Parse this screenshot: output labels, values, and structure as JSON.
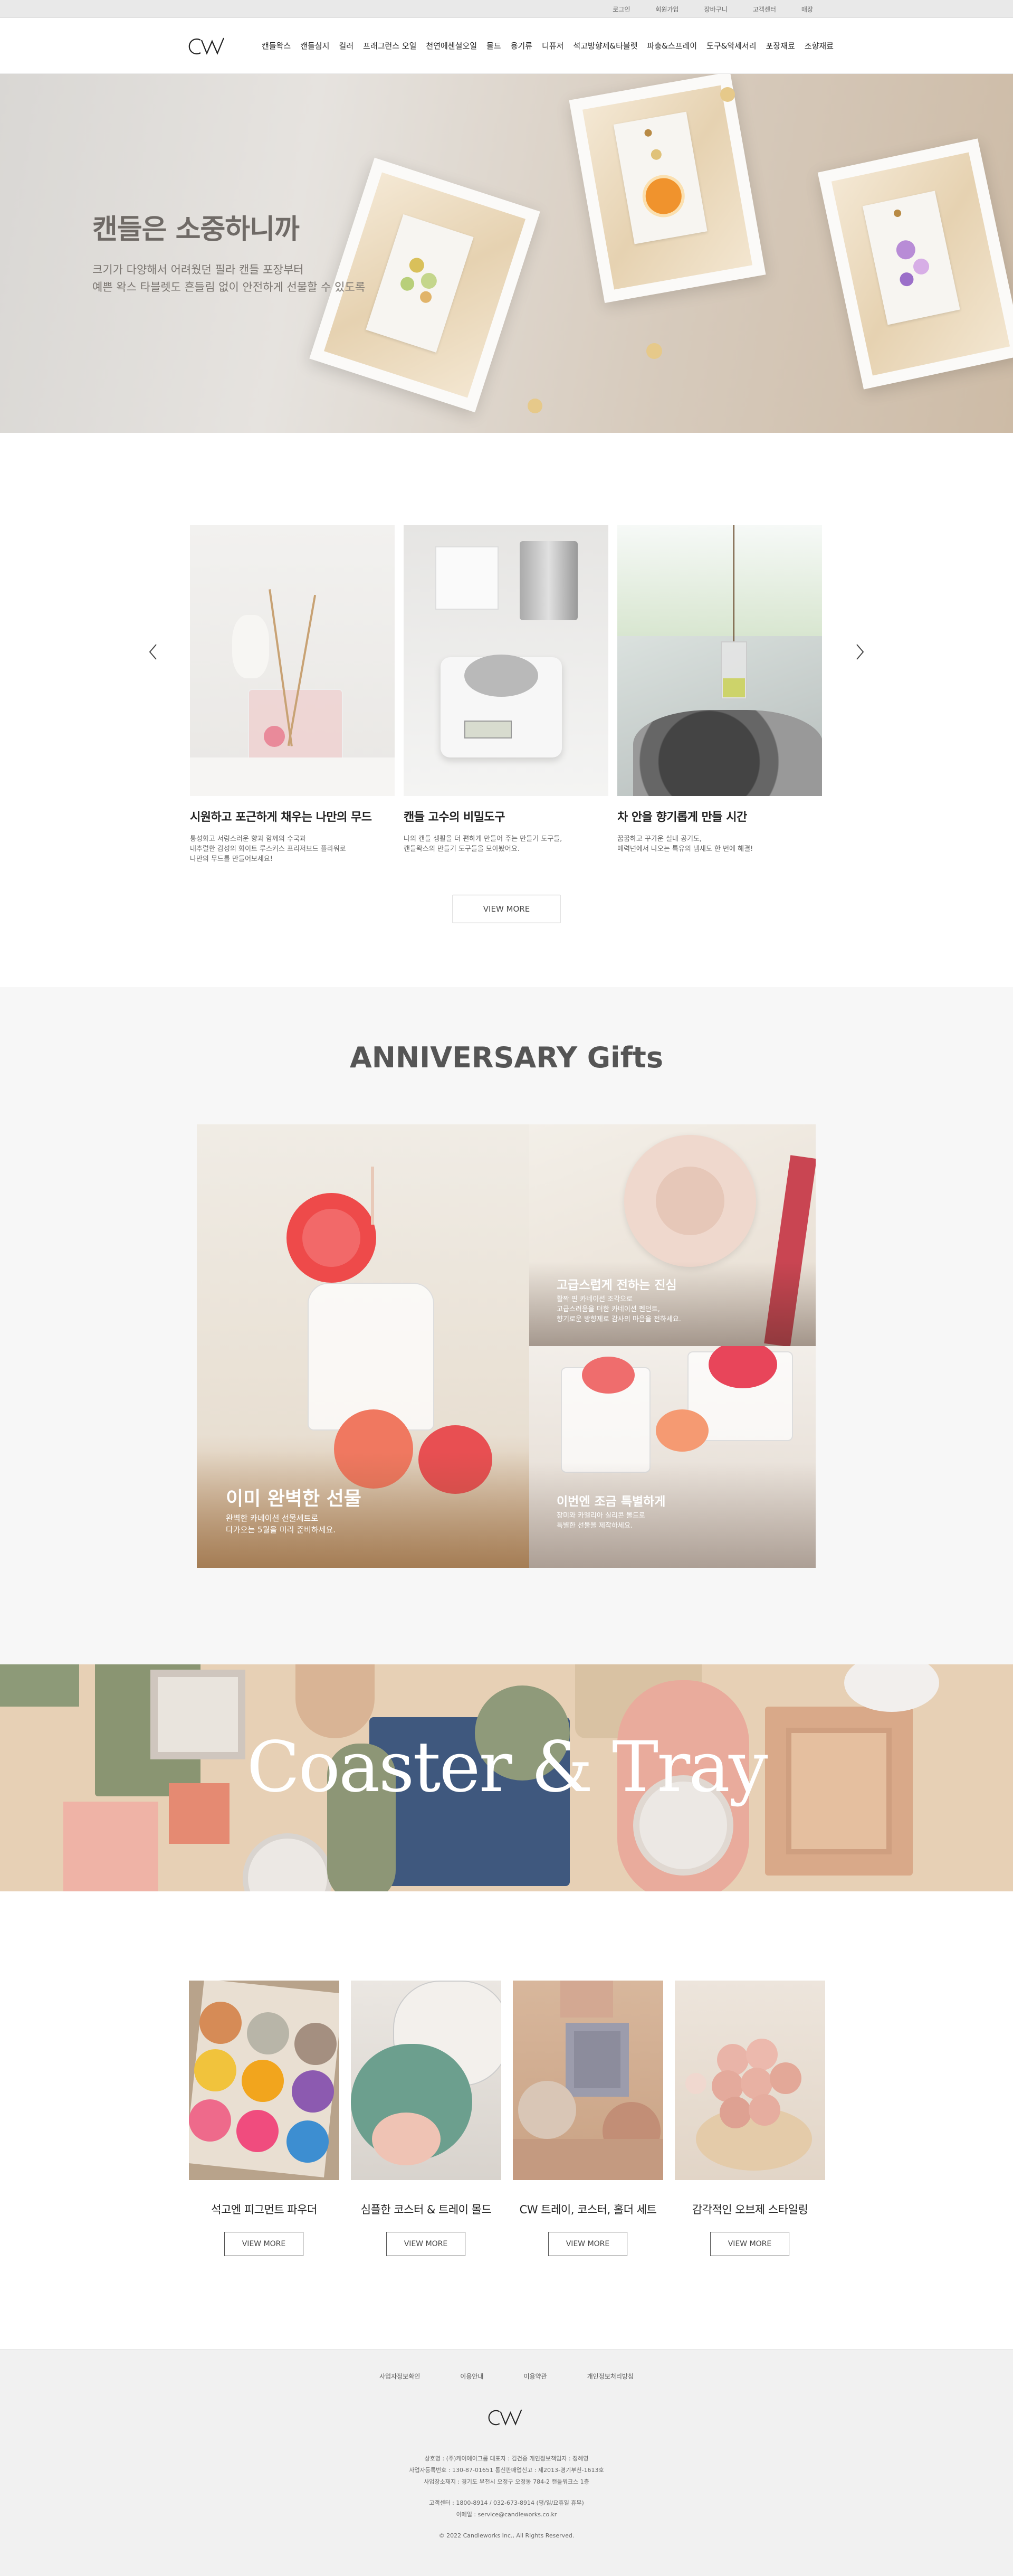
{
  "topbar": {
    "links": [
      "로그인",
      "회원가입",
      "장바구니",
      "고객센터",
      "매장"
    ]
  },
  "header": {
    "logo_alt": "CW",
    "nav": [
      "캔들왁스",
      "캔들심지",
      "컬러",
      "프래그런스 오일",
      "천연에센셜오일",
      "몰드",
      "용기류",
      "디퓨저",
      "석고방향제&타블렛",
      "파충&스프레이",
      "도구&악세서리",
      "포장재료",
      "조향재료"
    ]
  },
  "hero": {
    "title": "캔들은 소중하니까",
    "subtitle_line1": "크기가 다양해서 어려웠던 필라 캔들 포장부터",
    "subtitle_line2": "예쁜 왁스 타블렛도 흔들림 없이 안전하게 선물할 수 있도록"
  },
  "blog": {
    "cards": [
      {
        "title": "시원하고 포근하게 채우는 나만의 무드",
        "desc": "통성화고 서렁스러운 향과 함께의 수국과\n내추럴한 감성의 화이트 루스커스 프리저브드 플라워로\n나만의 무드를 만들어보세요!"
      },
      {
        "title": "캔들 고수의 비밀도구",
        "desc": "나의 캔들 생활을 더 편하게 만들어 주는 만들기 도구들,\n캔들왁스의 만들기 도구들을 모아봤어요."
      },
      {
        "title": "차 안을 향기롭게 만들 시간",
        "desc": "꿉꿉하고 꾸가운 실내 공기도,\n매력넌에서 나오는 특유의 냄새도 한 번에 해결!"
      }
    ],
    "more_label": "VIEW MORE",
    "prev_icon": "chevron-left-icon",
    "next_icon": "chevron-right-icon"
  },
  "anniversary": {
    "title": "ANNIVERSARY Gifts",
    "main_panel": {
      "title": "이미 완벽한 선물",
      "desc": "완벽한 카네이션 선물세트로\n다가오는 5월을 미리 준비하세요."
    },
    "top_panel": {
      "title": "고급스럽게 전하는 진심",
      "desc": "활짝 핀 카네이션 조각으로\n고급스러움을 더한 카네이션 펜던트,\n향기로운 방향제로 감사의 마음을 전하세요."
    },
    "bottom_panel": {
      "title": "이번엔 조금 특별하게",
      "desc": "장미와 카멜리아 실리콘 몰드로\n특별한 선물을 제작하세요."
    }
  },
  "coaster": {
    "title": "Coaster & Tray"
  },
  "products": {
    "items": [
      {
        "title": "석고엔 피그먼트 파우더"
      },
      {
        "title": "심플한 코스터 & 트레이 몰드"
      },
      {
        "title": "CW 트레이, 코스터, 홀더 세트"
      },
      {
        "title": "감각적인 오브제 스타일링"
      }
    ],
    "more_label": "VIEW MORE"
  },
  "footer": {
    "links": [
      "사업자정보확인",
      "이용안내",
      "이용약관",
      "개인정보처리방침"
    ],
    "info_line1": "상호명 : (주)케이에이그룹 대표자 : 김건중 개인정보책임자 : 정혜영",
    "info_line2": "사업자등록번호 : 130-87-01651 통신판매업신고 : 제2013-경기부천-1613호",
    "info_line3": "사업장소재지 : 경기도 부천시 오정구 오정동 784-2 캔들워크스 1층",
    "info_line4": "고객센터 : 1800-8914 / 032-673-8914 (평/일/요휴일 휴무)",
    "info_line5": "이메일 : service@candleworks.co.kr",
    "copyright": "© 2022 Candleworks Inc., All Rights Reserved."
  }
}
